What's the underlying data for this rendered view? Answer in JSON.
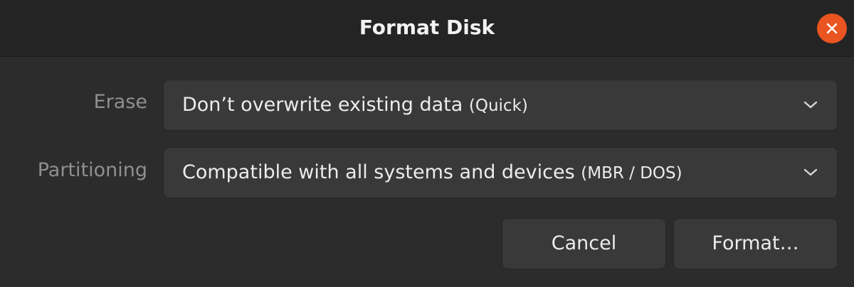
{
  "window": {
    "title": "Format Disk",
    "close_icon": "close-icon",
    "accent_color": "#e95420"
  },
  "erase": {
    "label": "Erase",
    "value_main": "Don’t overwrite existing data",
    "value_sub": "(Quick)"
  },
  "partitioning": {
    "label": "Partitioning",
    "value_main": "Compatible with all systems and devices",
    "value_sub": "(MBR / DOS)"
  },
  "buttons": {
    "cancel": "Cancel",
    "format": "Format…"
  }
}
